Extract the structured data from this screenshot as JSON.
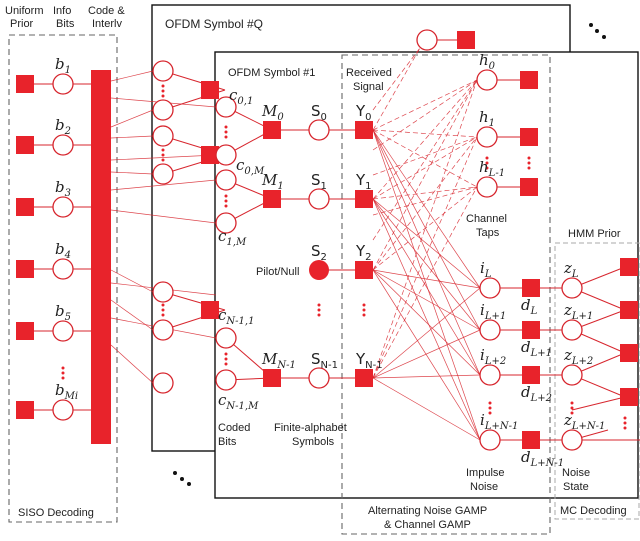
{
  "figure": {
    "type": "factor-graph",
    "colors": {
      "node": "#e8232b",
      "edge": "#d7262e",
      "frame": "#111111",
      "group": "#666666"
    }
  },
  "headers": {
    "uniform_prior": [
      "Uniform",
      "Prior"
    ],
    "info_bits": [
      "Info",
      "Bits"
    ],
    "code_interleave": [
      "Code &",
      "Interlv"
    ]
  },
  "frames": {
    "symbol_q": "OFDM Symbol #Q",
    "symbol_1": "OFDM Symbol #1"
  },
  "groups": {
    "siso": "SISO Decoding",
    "gamp": [
      "Alternating Noise GAMP",
      "& Channel GAMP"
    ],
    "mc": "MC Decoding",
    "hmm": "HMM Prior"
  },
  "sections": {
    "received_signal": [
      "Received",
      "Signal"
    ],
    "channel_taps": [
      "Channel",
      "Taps"
    ],
    "coded_bits": [
      "Coded",
      "Bits"
    ],
    "finite_alphabet": [
      "Finite-alphabet",
      "Symbols"
    ],
    "impulse_noise": [
      "Impulse",
      "Noise"
    ],
    "noise_state": [
      "Noise",
      "State"
    ],
    "pilot_null": "Pilot/Null"
  },
  "info_bits": [
    {
      "base": "b",
      "sub": "1"
    },
    {
      "base": "b",
      "sub": "2"
    },
    {
      "base": "b",
      "sub": "3"
    },
    {
      "base": "b",
      "sub": "4"
    },
    {
      "base": "b",
      "sub": "5"
    },
    {
      "base": "b",
      "sub": "Mi"
    }
  ],
  "coded_bits": [
    {
      "base": "c",
      "sub": "0,1"
    },
    {
      "base": "c",
      "sub": "0,M"
    },
    {
      "base": "c",
      "sub": "1,M"
    },
    {
      "base": "c",
      "sub": "N-1,1"
    },
    {
      "base": "c",
      "sub": "N-1,M"
    }
  ],
  "mappers": [
    {
      "base": "M",
      "sub": "0"
    },
    {
      "base": "M",
      "sub": "1"
    },
    {
      "base": "M",
      "sub": "N-1"
    }
  ],
  "symbols": [
    {
      "base": "S",
      "sub": "0"
    },
    {
      "base": "S",
      "sub": "1"
    },
    {
      "base": "S",
      "sub": "2"
    },
    {
      "base": "S",
      "sub": "N-1"
    }
  ],
  "received": [
    {
      "base": "Y",
      "sub": "0"
    },
    {
      "base": "Y",
      "sub": "1"
    },
    {
      "base": "Y",
      "sub": "2"
    },
    {
      "base": "Y",
      "sub": "N-1"
    }
  ],
  "taps": [
    {
      "base": "h",
      "sub": "0"
    },
    {
      "base": "h",
      "sub": "1"
    },
    {
      "base": "h",
      "sub": "L-1"
    }
  ],
  "impulse": [
    {
      "base": "i",
      "sub": "L"
    },
    {
      "base": "i",
      "sub": "L+1"
    },
    {
      "base": "i",
      "sub": "L+2"
    },
    {
      "base": "i",
      "sub": "L+N-1"
    }
  ],
  "dfactors": [
    {
      "base": "d",
      "sub": "L"
    },
    {
      "base": "d",
      "sub": "L+1"
    },
    {
      "base": "d",
      "sub": "L+2"
    },
    {
      "base": "d",
      "sub": "L+N-1"
    }
  ],
  "states": [
    {
      "base": "z",
      "sub": "L"
    },
    {
      "base": "z",
      "sub": "L+1"
    },
    {
      "base": "z",
      "sub": "L+2"
    },
    {
      "base": "z",
      "sub": "L+N-1"
    }
  ]
}
